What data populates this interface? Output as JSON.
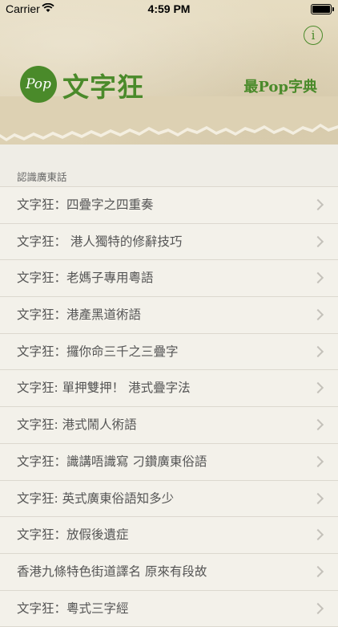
{
  "status_bar": {
    "carrier": "Carrier",
    "time": "4:59 PM"
  },
  "header": {
    "info_label": "i",
    "logo_badge": "Pop",
    "logo_text": "文字狂",
    "tagline": "最Pop字典"
  },
  "section": {
    "title": "認識廣東話"
  },
  "rows": [
    {
      "label": "文字狂：四疊字之四重奏"
    },
    {
      "label": "文字狂：  港人獨特的修辭技巧"
    },
    {
      "label": "文字狂：老媽子專用粵語"
    },
    {
      "label": "文字狂：港產黑道術語"
    },
    {
      "label": "文字狂：攞你命三千之三疊字"
    },
    {
      "label": "文字狂: 單押雙押！ 港式疊字法"
    },
    {
      "label": "文字狂:  港式鬧人術語"
    },
    {
      "label": "文字狂：識講唔識寫  刁鑽廣東俗語"
    },
    {
      "label": "文字狂: 英式廣東俗語知多少"
    },
    {
      "label": "文字狂：放假後遺症"
    },
    {
      "label": "香港九條特色街道譯名    原來有段故"
    },
    {
      "label": "文字狂：粵式三字經"
    }
  ],
  "colors": {
    "brand_green": "#4a8a2a",
    "background": "#efede6"
  }
}
